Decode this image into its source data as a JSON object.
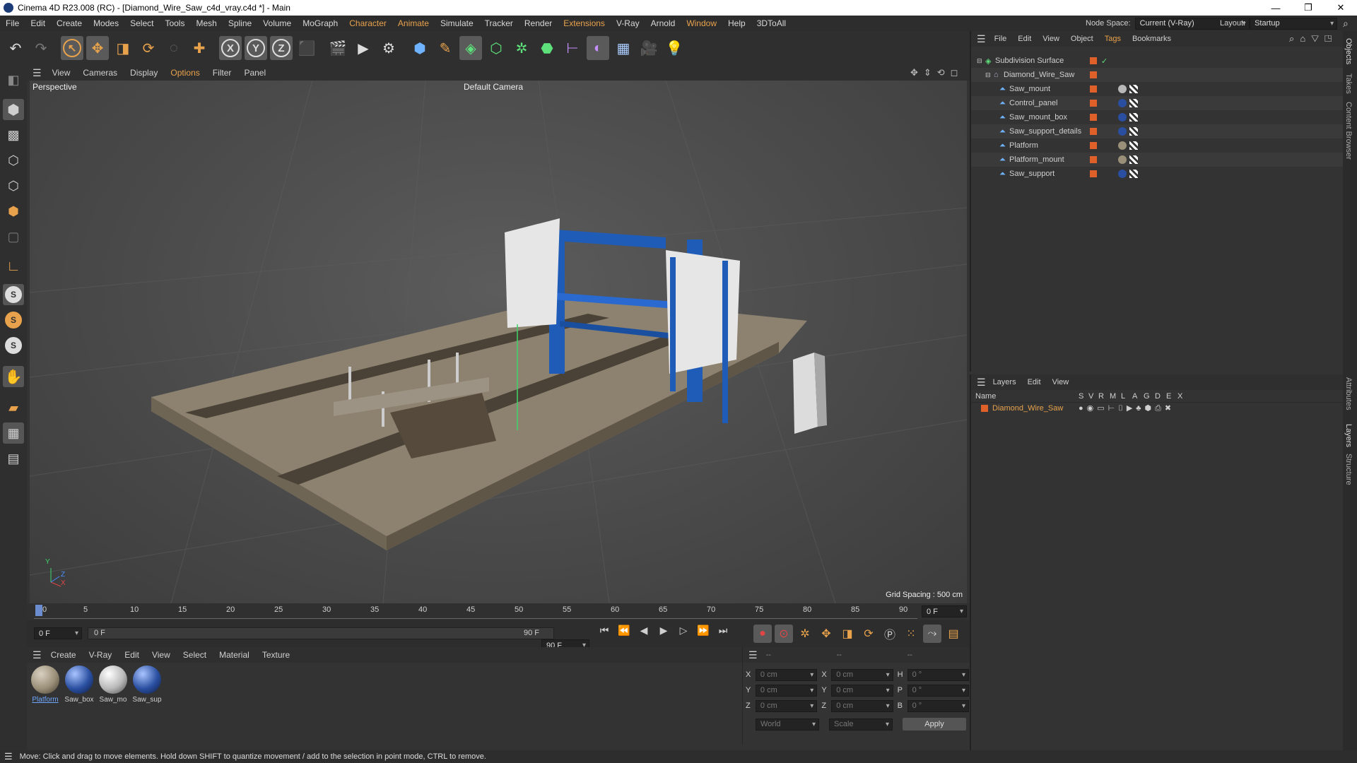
{
  "window": {
    "title": "Cinema 4D R23.008 (RC) - [Diamond_Wire_Saw_c4d_vray.c4d *] - Main",
    "buttons": [
      "—",
      "❐",
      "✕"
    ]
  },
  "menubar": {
    "items": [
      "File",
      "Edit",
      "Create",
      "Modes",
      "Select",
      "Tools",
      "Mesh",
      "Spline",
      "Volume",
      "MoGraph",
      "Character",
      "Animate",
      "Simulate",
      "Tracker",
      "Render",
      "Extensions",
      "V-Ray",
      "Arnold",
      "Window",
      "Help",
      "3DToAll"
    ],
    "node_space_label": "Node Space:",
    "node_space_value": "Current (V-Ray)",
    "layout_label": "Layout:",
    "layout_value": "Startup"
  },
  "viewport": {
    "menu": [
      "View",
      "Cameras",
      "Display",
      "Options",
      "Filter",
      "Panel"
    ],
    "name": "Perspective",
    "camera": "Default Camera",
    "grid_spacing": "Grid Spacing : 500 cm",
    "axis_labels": [
      "Y",
      "Z",
      "X"
    ]
  },
  "timeline": {
    "ticks": [
      "0",
      "5",
      "10",
      "15",
      "20",
      "25",
      "30",
      "35",
      "40",
      "45",
      "50",
      "55",
      "60",
      "65",
      "70",
      "75",
      "80",
      "85",
      "90"
    ],
    "current_frame": "0 F"
  },
  "transport": {
    "start_frame": "0 F",
    "slider_start": "0 F",
    "slider_end": "90 F",
    "end_frame": "90 F"
  },
  "materials": {
    "menu": [
      "Create",
      "V-Ray",
      "Edit",
      "View",
      "Select",
      "Material",
      "Texture"
    ],
    "items": [
      {
        "label": "Platform",
        "color": "#9a8f78"
      },
      {
        "label": "Saw_box",
        "color": "#2a4fa0"
      },
      {
        "label": "Saw_mo",
        "color": "#b8b8b8"
      },
      {
        "label": "Saw_sup",
        "color": "#2a4fa0"
      }
    ]
  },
  "coords": {
    "header": [
      "--",
      "--",
      "--"
    ],
    "rows": [
      {
        "a": "X",
        "av": "0 cm",
        "b": "X",
        "bv": "0 cm",
        "c": "H",
        "cv": "0 °"
      },
      {
        "a": "Y",
        "av": "0 cm",
        "b": "Y",
        "bv": "0 cm",
        "c": "P",
        "cv": "0 °"
      },
      {
        "a": "Z",
        "av": "0 cm",
        "b": "Z",
        "bv": "0 cm",
        "c": "B",
        "cv": "0 °"
      }
    ],
    "world": "World",
    "scale": "Scale",
    "apply": "Apply"
  },
  "objects": {
    "menu": [
      "File",
      "Edit",
      "View",
      "Object",
      "Tags",
      "Bookmarks"
    ],
    "items": [
      {
        "name": "Subdivision Surface",
        "level": 0
      },
      {
        "name": "Diamond_Wire_Saw",
        "level": 1
      },
      {
        "name": "Saw_mount",
        "level": 2
      },
      {
        "name": "Control_panel",
        "level": 2
      },
      {
        "name": "Saw_mount_box",
        "level": 2
      },
      {
        "name": "Saw_support_details",
        "level": 2
      },
      {
        "name": "Platform",
        "level": 2
      },
      {
        "name": "Platform_mount",
        "level": 2
      },
      {
        "name": "Saw_support",
        "level": 2
      }
    ]
  },
  "layers": {
    "menu": [
      "Layers",
      "Edit",
      "View"
    ],
    "columns": [
      "Name",
      "S",
      "V",
      "R",
      "M",
      "L",
      "A",
      "G",
      "D",
      "E",
      "X"
    ],
    "rows": [
      {
        "name": "Diamond_Wire_Saw",
        "color": "#e0602a"
      }
    ]
  },
  "right_tabs": [
    "Objects",
    "Takes",
    "Content Browser",
    "Attributes",
    "Layers",
    "Structure"
  ],
  "status": "Move: Click and drag to move elements. Hold down SHIFT to quantize movement / add to the selection in point mode, CTRL to remove.",
  "colors": {
    "accent": "#e8a24c",
    "layer": "#e0602a",
    "saw_blue": "#1f5cb8"
  }
}
